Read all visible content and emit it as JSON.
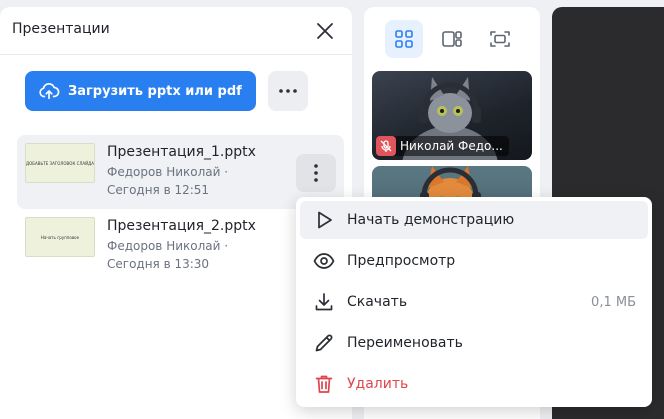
{
  "panel": {
    "title": "Презентации",
    "upload_label": "Загрузить pptx или pdf"
  },
  "files": [
    {
      "name": "Презентация_1.pptx",
      "author": "Федоров Николай ·",
      "date": "Сегодня в 12:51",
      "thumb_text": "ДОБАВЬТЕ ЗАГОЛОВОК СЛАЙДА"
    },
    {
      "name": "Презентация_2.pptx",
      "author": "Федоров Николай ·",
      "date": "Сегодня в 13:30",
      "thumb_text": "Начать групповое"
    }
  ],
  "participants": [
    {
      "name": "Николай Федо..."
    }
  ],
  "menu": {
    "items": [
      {
        "label": "Начать демонстрацию",
        "icon": "play-icon"
      },
      {
        "label": "Предпросмотр",
        "icon": "eye-icon"
      },
      {
        "label": "Скачать",
        "icon": "download-icon",
        "size": "0,1 МБ"
      },
      {
        "label": "Переименовать",
        "icon": "pencil-icon"
      },
      {
        "label": "Удалить",
        "icon": "trash-icon"
      }
    ]
  },
  "colors": {
    "accent": "#2a7ff0",
    "danger": "#e0454d",
    "dark_bg": "#2b2b2d"
  }
}
